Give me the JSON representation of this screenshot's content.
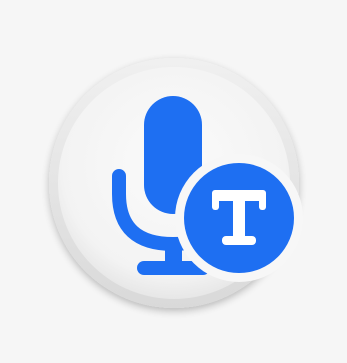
{
  "icon": {
    "name": "voice-to-text-app-icon",
    "glyph_letter": "T",
    "colors": {
      "background": "#f6f6f6",
      "disc_outer": "#e8e8e8",
      "disc_inner": "#f7f7f7",
      "accent_blue": "#1e6ff2",
      "glyph_white": "#ffffff"
    }
  }
}
